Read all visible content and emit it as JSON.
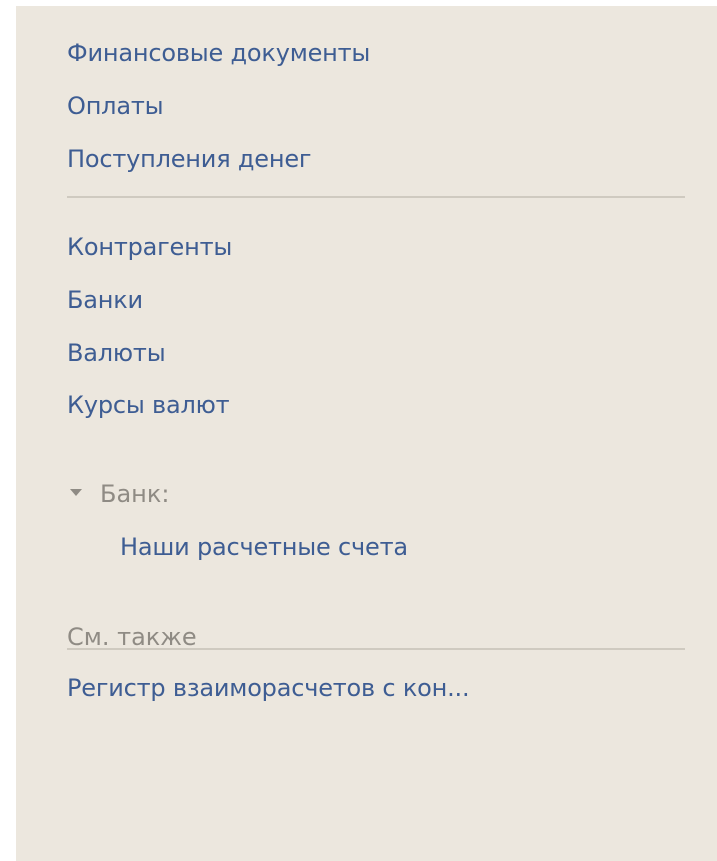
{
  "nav": {
    "group1": [
      "Финансовые документы",
      "Оплаты",
      "Поступления денег"
    ],
    "group2": [
      "Контрагенты",
      "Банки",
      "Валюты",
      "Курсы валют"
    ],
    "bank_group": {
      "title": "Банк:",
      "items": [
        "Наши расчетные счета"
      ]
    },
    "see_also": {
      "title": "См. также",
      "items": [
        "Регистр взаиморасчетов с кон..."
      ]
    }
  },
  "colors": {
    "panel_bg": "#ece7de",
    "link": "#3e5d93",
    "muted": "#8f8b84",
    "separator": "#cfcac0"
  },
  "icons": {
    "bank_group_toggle": "triangle-down-icon"
  }
}
